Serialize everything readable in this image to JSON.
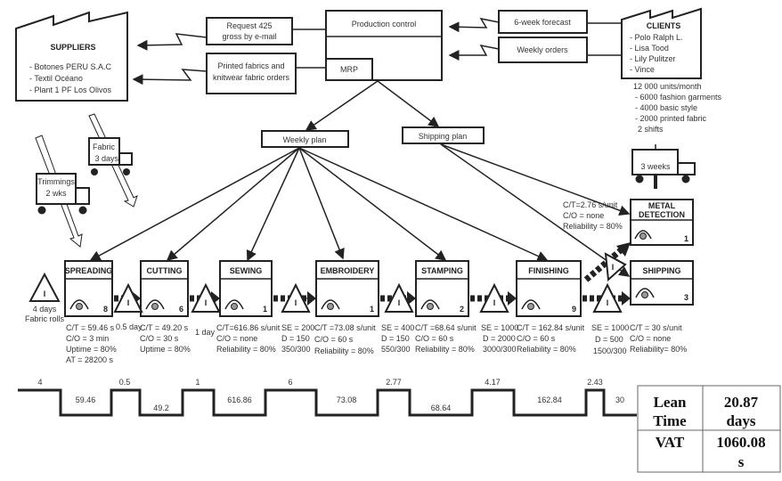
{
  "suppliers": {
    "title": "SUPPLIERS",
    "items": [
      "- Botones PERU S.A.C",
      "- Textil Océano",
      "- Plant 1 PF Los Olivos"
    ]
  },
  "clients": {
    "title": "CLIENTS",
    "items": [
      "- Polo Ralph L.",
      "- Lisa Tood",
      "- Lily Pulitzer",
      "- Vince"
    ],
    "demand": [
      "12 000 units/month",
      "- 6000 fashion garments",
      "- 4000 basic style",
      "- 2000 printed fabric",
      "2 shifts"
    ]
  },
  "info": {
    "request": [
      "Request 425",
      "gross by e-mail"
    ],
    "printed": [
      "Printed fabrics and",
      "knitwear fabric orders"
    ],
    "production_control": "Production control",
    "mrp": "MRP",
    "forecast": "6-week forecast",
    "weekly_orders": "Weekly orders",
    "weekly_plan": "Weekly plan",
    "shipping_plan": "Shipping plan"
  },
  "trucks": {
    "fabric": [
      "Fabric",
      "3 days"
    ],
    "trimmings": [
      "Trimmings",
      "2 wks"
    ],
    "clients": "3 weeks"
  },
  "inventory_start": [
    "4 days",
    "Fabric rolls"
  ],
  "inventory_symbol": "I",
  "processes": [
    {
      "name": "SPREADING",
      "operators": "8",
      "data": [
        "C/T = 59.46 s",
        "C/O = 3 min",
        "Uptime = 80%",
        "AT = 28200 s"
      ]
    },
    {
      "name": "CUTTING",
      "operators": "6",
      "data": [
        "C/T = 49.20 s",
        "C/O = 30 s",
        "Uptime = 80%"
      ]
    },
    {
      "name": "SEWING",
      "operators": "1",
      "data": [
        "C/T=616.86 s/unit",
        "C/O = none",
        "Reliability = 80%"
      ]
    },
    {
      "name": "EMBROIDERY",
      "operators": "1",
      "data": [
        "C/T =73.08 s/unit",
        "C/O = 60 s",
        "Reliability = 80%"
      ]
    },
    {
      "name": "STAMPING",
      "operators": "2",
      "data": [
        "C/T =68.64 s/unit",
        "C/O = 60 s",
        "Reliability = 80%"
      ]
    },
    {
      "name": "FINISHING",
      "operators": "9",
      "data": [
        "C/T = 162.84 s/unit",
        "C/O = 60 s",
        "Reliability = 80%"
      ]
    },
    {
      "name": "SHIPPING",
      "operators": "3",
      "data": [
        "C/T = 30 s/unit",
        "C/O = none",
        "Reliability= 80%"
      ]
    }
  ],
  "metal_detection": {
    "name": [
      "METAL",
      "DETECTION"
    ],
    "operators": "1",
    "data": [
      "C/T=2.76 s/unit",
      "C/O = none",
      "Reliability = 80%"
    ]
  },
  "wip": {
    "spread_cut": "0.5 day",
    "cut_sew": "1 day",
    "sew_emb": [
      "SE = 200",
      "D = 150",
      "350/300"
    ],
    "emb_stamp": [
      "SE = 400",
      "D = 150",
      "550/300"
    ],
    "stamp_fin": [
      "SE = 1000",
      "D = 2000",
      "3000/300"
    ],
    "fin_ship": [
      "SE = 1000",
      "D = 500",
      "1500/300"
    ]
  },
  "timeline": {
    "wait": [
      "4",
      "0.5",
      "1",
      "6",
      "2.77",
      "4.17",
      "2.43"
    ],
    "process": [
      "59.46",
      "49.2",
      "616.86",
      "73.08",
      "68.64",
      "162.84",
      "30"
    ]
  },
  "summary": {
    "lean_label": [
      "Lean",
      "Time"
    ],
    "lean_value": [
      "20.87",
      "days"
    ],
    "vat_label": "VAT",
    "vat_value": [
      "1060.08",
      "s"
    ]
  }
}
